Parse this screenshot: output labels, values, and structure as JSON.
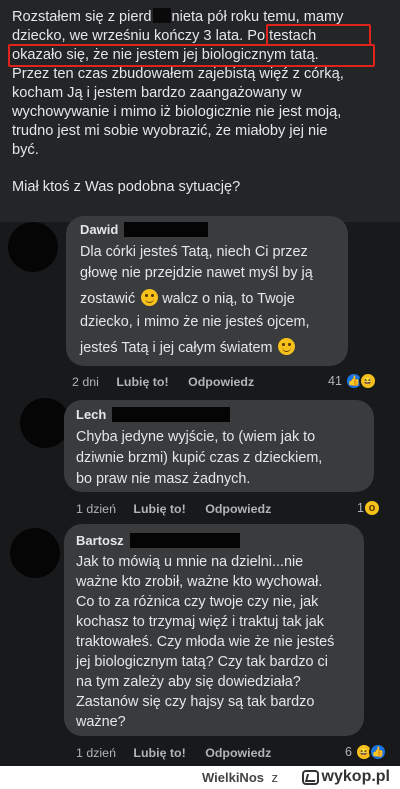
{
  "post": {
    "lines": [
      {
        "pre": "Rozstałem się z pierd",
        "post": "nieta pół roku temu, mamy"
      },
      "dziecko, we wrześniu kończy 3 lata.",
      "Po testach",
      "okazało się, że nie jestem jej biologicznym tatą.",
      "Przez ten czas zbudowałem zajebistą więź z córką,",
      "kocham Ją i jestem bardzo zaangażowany w",
      "wychowywanie i mimo iż biologicznie nie jest moją,",
      "trudno jest mi sobie wyobrazić, że miałoby jej nie",
      "być.",
      "Miał ktoś z Was podobna sytuację?"
    ]
  },
  "comments": [
    {
      "author": "Dawid",
      "lines": [
        "Dla córki jesteś Tatą, niech Ci przez",
        "głowę nie przejdzie nawet myśl by ją",
        "zostawić",
        "walcz o nią, to Twoje",
        "dziecko, i mimo że nie jesteś ojcem,",
        "jesteś Tatą i jej całym światem"
      ],
      "time": "2 dni",
      "like": "Lubię to!",
      "reply": "Odpowiedz",
      "reactions": "41",
      "reaction_icons": [
        "like-icon",
        "haha-icon"
      ]
    },
    {
      "author": "Lech",
      "lines": [
        "Chyba jedyne wyjście, to (wiem jak to",
        "dziwnie brzmi) kupić czas z dzieckiem,",
        "bo praw nie masz żadnych."
      ],
      "time": "1 dzień",
      "like": "Lubię to!",
      "reply": "Odpowiedz",
      "reactions": "1",
      "reaction_icons": [
        "wow-icon"
      ]
    },
    {
      "author": "Bartosz",
      "lines": [
        "Jak to mówią u mnie na dzielni...nie",
        "ważne kto zrobił, ważne kto wychował.",
        "Co to za różnica czy twoje czy nie, jak",
        "kochasz to trzymaj więź i traktuj tak jak",
        "traktowałeś. Czy młoda wie że nie jesteś",
        "jej biologicznym tatą? Czy tak bardzo ci",
        "na tym zależy aby się dowiedziała?",
        "Zastanów się czy hajsy są tak bardzo",
        "ważne?"
      ],
      "time": "1 dzień",
      "like": "Lubię to!",
      "reply": "Odpowiedz",
      "reactions": "6",
      "reaction_icons": [
        "haha-icon",
        "like-icon"
      ]
    }
  ],
  "watermark": {
    "user": "WielkiNos",
    "z": "z",
    "site": "wykop.pl"
  },
  "colors": {
    "post_bg": "#242526",
    "comments_bg": "#18191a",
    "bubble_bg": "#3a3b3c",
    "highlight": "#e0241c",
    "text": "#e4e6eb",
    "meta": "#b0b3b8"
  }
}
